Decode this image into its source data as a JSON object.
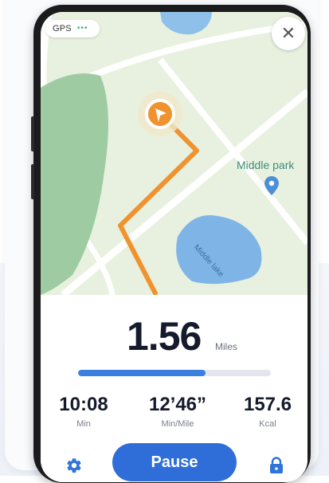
{
  "map": {
    "gps_label": "GPS",
    "gps_dots": "•••",
    "poi_label": "Middle park",
    "lake_label": "Middle lake",
    "close_symbol": "✕"
  },
  "icons": {
    "close": "close-icon",
    "location": "location-arrow-icon",
    "poi": "map-pin-icon",
    "settings": "gear-icon",
    "lock": "lock-icon"
  },
  "workout": {
    "distance_value": "1.56",
    "distance_unit": "Miles",
    "route_progress": 0.66,
    "stats": [
      {
        "value": "10:08",
        "label": "Min"
      },
      {
        "value": "12’46”",
        "label": "Min/Mile"
      },
      {
        "value": "157.6",
        "label": "Kcal"
      }
    ],
    "pause_label": "Pause"
  },
  "colors": {
    "accent": "#2f6ed8",
    "route": "#f0922e",
    "gps_indicator": "#37b36b",
    "park": "#9fcba2",
    "lake": "#7fb5e6"
  }
}
